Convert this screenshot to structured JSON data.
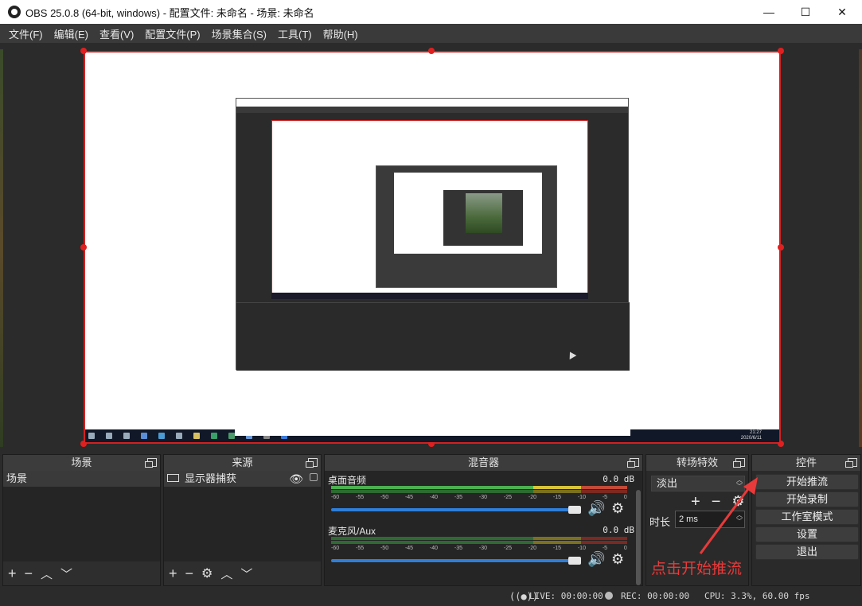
{
  "window": {
    "title": "OBS 25.0.8 (64-bit, windows) - 配置文件: 未命名 - 场景: 未命名",
    "minimize": "—",
    "maximize": "☐",
    "close": "✕"
  },
  "menu": [
    "文件(F)",
    "编辑(E)",
    "查看(V)",
    "配置文件(P)",
    "场景集合(S)",
    "工具(T)",
    "帮助(H)"
  ],
  "taskbar": {
    "time": "21:27",
    "date": "2020/6/11"
  },
  "scenes": {
    "header": "场景",
    "items": [
      "场景"
    ]
  },
  "sources": {
    "header": "来源",
    "items": [
      {
        "name": "显示器捕获",
        "icon": "monitor-icon"
      }
    ]
  },
  "mixer": {
    "header": "混音器",
    "scale": [
      "-60",
      "-55",
      "-50",
      "-45",
      "-40",
      "-35",
      "-30",
      "-25",
      "-20",
      "-15",
      "-10",
      "-5",
      "0"
    ],
    "tracks": [
      {
        "name": "桌面音频",
        "db": "0.0 dB"
      },
      {
        "name": "麦克风/Aux",
        "db": "0.0 dB"
      }
    ]
  },
  "transitions": {
    "header": "转场特效",
    "selected": "淡出",
    "duration_label": "时长",
    "duration_value": "2 ms"
  },
  "controls": {
    "header": "控件",
    "buttons": [
      "开始推流",
      "开始录制",
      "工作室模式",
      "设置",
      "退出"
    ]
  },
  "status": {
    "live": "LIVE: 00:00:00",
    "rec": "REC: 00:00:00",
    "cpu": "CPU: 3.3%, 60.00 fps"
  },
  "annotation": {
    "text": "点击开始推流",
    "color": "#e83a3a"
  },
  "colors": {
    "selection": "#d32020",
    "meter_green": "#4caf50",
    "meter_yellow": "#d8c43a",
    "meter_red": "#c24a3a",
    "volume": "#2f7ed8"
  }
}
